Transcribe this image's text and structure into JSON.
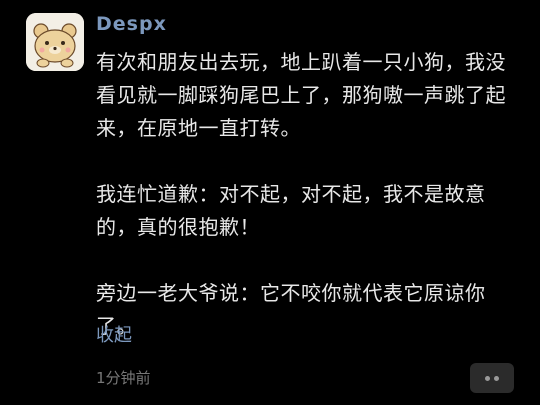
{
  "post": {
    "username": "Despx",
    "paragraphs": [
      "有次和朋友出去玩，地上趴着一只小狗，我没看见就一脚踩狗尾巴上了，那狗嗷一声跳了起来，在原地一直打转。",
      "我连忙道歉：对不起，对不起，我不是故意的，真的很抱歉！",
      "旁边一老大爷说：它不咬你就代表它原谅你了。"
    ],
    "collapse_label": "收起",
    "timestamp": "1分钟前"
  },
  "avatar_icon": "cartoon-bear-icon",
  "more_icon": "ellipsis-icon",
  "colors": {
    "background": "#000000",
    "link": "#7c98bd",
    "text": "#e8e8e8",
    "muted": "#777777"
  }
}
